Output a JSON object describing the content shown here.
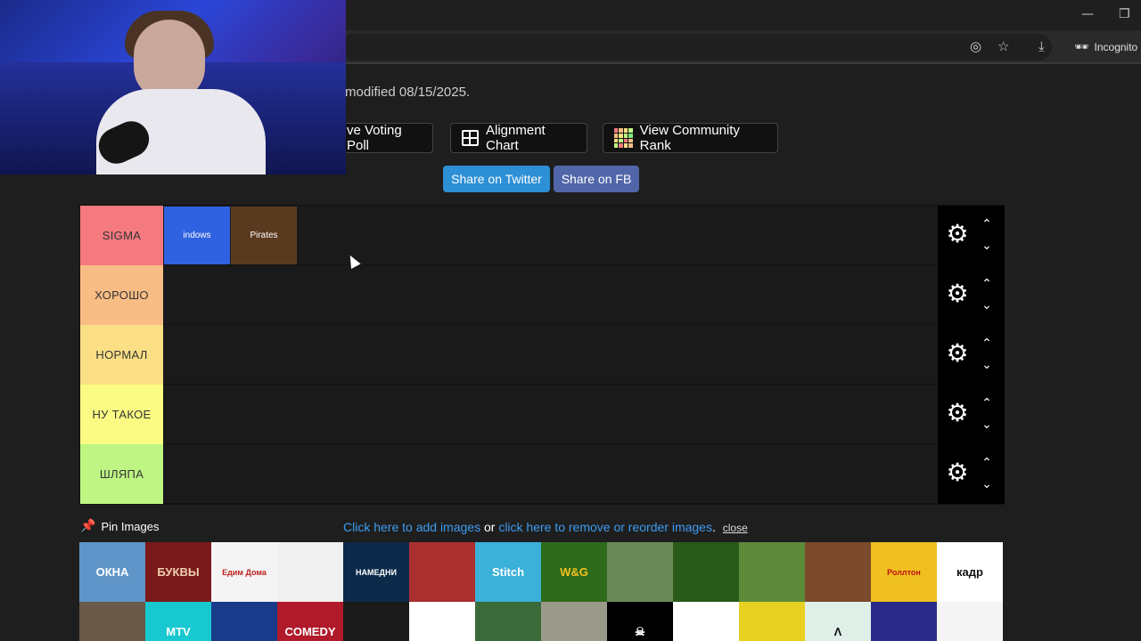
{
  "browser": {
    "minimize_glyph": "—",
    "restore_glyph": "❐",
    "eye_off_glyph": "◎",
    "star_glyph": "☆",
    "download_glyph": "⤓",
    "incognito_label": "Incognito"
  },
  "page": {
    "modified_text": "modified 08/15/2025.",
    "buttons": {
      "voting_poll": "ve Voting Poll",
      "alignment_chart": "Alignment Chart",
      "community_rank": "View Community Rank"
    },
    "share": {
      "twitter": "Share on Twitter",
      "facebook": "Share on FB",
      "twitter_color": "#2d8fd5",
      "facebook_color": "#5066a8"
    }
  },
  "tiers": [
    {
      "label": "SIGMA",
      "color": "#f47a80"
    },
    {
      "label": "ХОРОШО",
      "color": "#f8bd84"
    },
    {
      "label": "НОРМАЛ",
      "color": "#fbdf85"
    },
    {
      "label": "НУ ТАКОЕ",
      "color": "#fbfb83"
    },
    {
      "label": "ШЛЯПА",
      "color": "#bff683"
    }
  ],
  "tier_items": [
    {
      "name": "windows-xp",
      "text": "indows",
      "bg": "#2f62e0"
    },
    {
      "name": "pirates-caribbean",
      "text": "Pirates",
      "bg": "#5a3a1e"
    }
  ],
  "tier_controls": {
    "gear": "⚙",
    "up": "⌃",
    "down": "⌄"
  },
  "pin": {
    "label": "Pin Images",
    "icon": "📌"
  },
  "links": {
    "add": "Click here to add images",
    "or": " or ",
    "remove": "click here to remove or reorder images",
    "period": ".",
    "close": "close"
  },
  "pool": [
    {
      "text": "ОКНА",
      "bg": "#5f95c8",
      "fg": "#ffffff"
    },
    {
      "text": "БУКВЫ",
      "bg": "#7a1a1a",
      "fg": "#f0d0b0"
    },
    {
      "text": "Едим Дома",
      "bg": "#f4f4f4",
      "fg": "#c02020"
    },
    {
      "text": "",
      "bg": "#f0f0f0",
      "fg": "#333333"
    },
    {
      "text": "НАМЕДНИ",
      "bg": "#0c2b4a",
      "fg": "#ffffff"
    },
    {
      "text": "",
      "bg": "#aa3030",
      "fg": "#ffffff"
    },
    {
      "text": "Stitch",
      "bg": "#3bb0d8",
      "fg": "#ffffff"
    },
    {
      "text": "W&G",
      "bg": "#2d6a1a",
      "fg": "#f3c020"
    },
    {
      "text": "",
      "bg": "#6a8a5a",
      "fg": "#ffffff"
    },
    {
      "text": "",
      "bg": "#2a5a1a",
      "fg": "#ffffff"
    },
    {
      "text": "",
      "bg": "#5c8a3a",
      "fg": "#ffffff"
    },
    {
      "text": "",
      "bg": "#7a4a2a",
      "fg": "#ffffff"
    },
    {
      "text": "Роллтон",
      "bg": "#f0c020",
      "fg": "#c01010"
    },
    {
      "text": "кадр",
      "bg": "#ffffff",
      "fg": "#111111"
    },
    {
      "text": "",
      "bg": "#6a5a4a",
      "fg": "#ffffff"
    },
    {
      "text": "MTV",
      "bg": "#18c8d0",
      "fg": "#ffffff"
    },
    {
      "text": "",
      "bg": "#1a3a8a",
      "fg": "#ffffff"
    },
    {
      "text": "COMEDY",
      "bg": "#b01a2a",
      "fg": "#ffffff"
    },
    {
      "text": "",
      "bg": "#1a1a1a",
      "fg": "#ffffff"
    },
    {
      "text": "",
      "bg": "#ffffff",
      "fg": "#333333"
    },
    {
      "text": "",
      "bg": "#3a6a3a",
      "fg": "#ffffff"
    },
    {
      "text": "",
      "bg": "#9a9a8a",
      "fg": "#ffffff"
    },
    {
      "text": "☠",
      "bg": "#000000",
      "fg": "#ffffff"
    },
    {
      "text": "",
      "bg": "#ffffff",
      "fg": "#c01060"
    },
    {
      "text": "",
      "bg": "#e8d020",
      "fg": "#333333"
    },
    {
      "text": "Λ",
      "bg": "#e0f0e8",
      "fg": "#111111"
    },
    {
      "text": "",
      "bg": "#2a2a8a",
      "fg": "#ffffff"
    },
    {
      "text": "",
      "bg": "#f4f4f4",
      "fg": "#2a8a1a"
    }
  ]
}
